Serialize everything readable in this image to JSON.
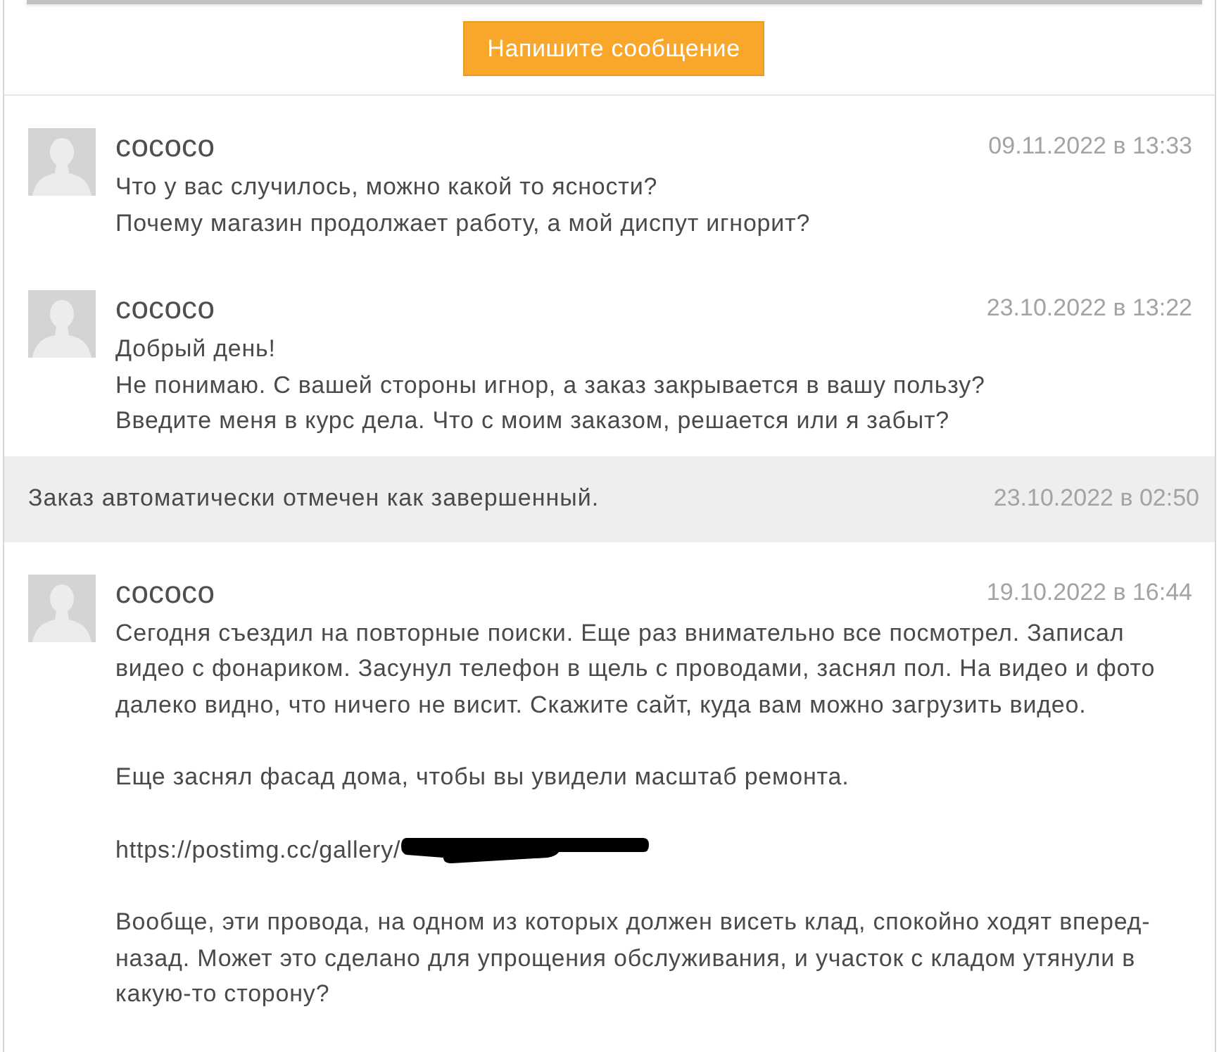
{
  "compose_button": {
    "label": "Напишите сообщение"
  },
  "messages": [
    {
      "kind": "user",
      "author": "сососо",
      "time": "09.11.2022 в 13:33",
      "paragraphs": [
        {
          "kind": "text",
          "text": "Что у вас случилось, можно какой то ясности?\nПочему магазин продолжает работу, а мой диспут игнорит?"
        }
      ]
    },
    {
      "kind": "user",
      "author": "сососо",
      "time": "23.10.2022 в 13:22",
      "paragraphs": [
        {
          "kind": "text",
          "text": "Добрый день!\nНе понимаю. С вашей стороны игнор, а заказ закрывается в вашу пользу?\nВведите меня в курс дела. Что с моим заказом, решается или я забыт?"
        }
      ]
    },
    {
      "kind": "system",
      "text": "Заказ автоматически отмечен как завершенный.",
      "time": "23.10.2022 в 02:50"
    },
    {
      "kind": "user",
      "author": "сососо",
      "time": "19.10.2022 в 16:44",
      "paragraphs": [
        {
          "kind": "text",
          "text": "Сегодня съездил на повторные поиски. Еще раз внимательно все посмотрел. Записал видео с фонариком. Засунул телефон в щель с проводами, заснял пол. На видео и фото далеко видно, что ничего не висит. Скажите сайт, куда вам можно загрузить видео."
        },
        {
          "kind": "text",
          "text": "Еще заснял фасад дома, чтобы вы увидели масштаб ремонта."
        },
        {
          "kind": "link",
          "text": "https://postimg.cc/gallery/",
          "redacted": true
        },
        {
          "kind": "text",
          "text": "Вообще, эти провода, на одном из которых должен висеть клад, спокойно ходят вперед-назад. Может это сделано для упрощения обслуживания, и участок с кладом утянули в какую-то сторону?"
        }
      ]
    }
  ]
}
